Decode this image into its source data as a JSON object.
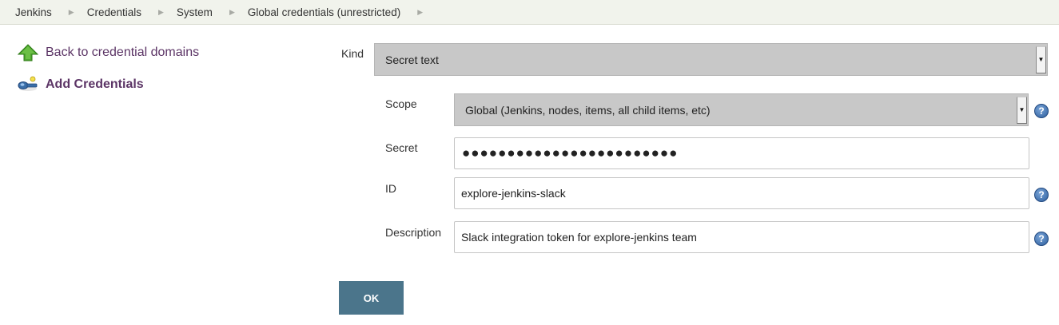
{
  "breadcrumb": {
    "items": [
      "Jenkins",
      "Credentials",
      "System",
      "Global credentials (unrestricted)"
    ],
    "separator": "▶"
  },
  "sidebar": {
    "back_label": "Back to credential domains",
    "add_label": "Add Credentials"
  },
  "form": {
    "kind": {
      "label": "Kind",
      "value": "Secret text"
    },
    "scope": {
      "label": "Scope",
      "value": "Global (Jenkins, nodes, items, all child items, etc)"
    },
    "secret": {
      "label": "Secret",
      "value": "●●●●●●●●●●●●●●●●●●●●●●●●"
    },
    "id": {
      "label": "ID",
      "value": "explore-jenkins-slack"
    },
    "description": {
      "label": "Description",
      "value": "Slack integration token for explore-jenkins team"
    },
    "help_glyph": "?",
    "dropdown_glyph": "▼"
  },
  "ok_label": "OK",
  "colors": {
    "link": "#5c3566",
    "ok_button": "#4b758b",
    "breadcrumb_bg": "#f1f3ec",
    "select_bg": "#c8c8c8"
  }
}
